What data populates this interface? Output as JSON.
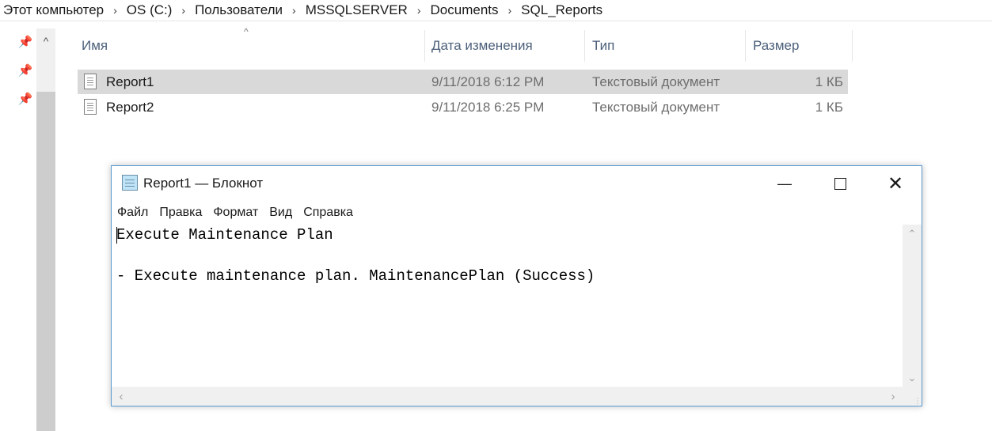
{
  "breadcrumb": {
    "items": [
      "Этот компьютер",
      "OS (C:)",
      "Пользователи",
      "MSSQLSERVER",
      "Documents",
      "SQL_Reports"
    ],
    "separator": "›"
  },
  "explorer": {
    "columns": {
      "name": "Имя",
      "date": "Дата изменения",
      "type": "Тип",
      "size": "Размер"
    },
    "sort_indicator": "^",
    "scroll_up": "^",
    "pin_icon": "📌",
    "files": [
      {
        "name": "Report1",
        "date": "9/11/2018 6:12 PM",
        "type": "Текстовый документ",
        "size": "1 КБ",
        "selected": true
      },
      {
        "name": "Report2",
        "date": "9/11/2018 6:25 PM",
        "type": "Текстовый документ",
        "size": "1 КБ",
        "selected": false
      }
    ]
  },
  "notepad": {
    "title": "Report1 — Блокнот",
    "buttons": {
      "minimize": "—",
      "close": "✕"
    },
    "menu": [
      "Файл",
      "Правка",
      "Формат",
      "Вид",
      "Справка"
    ],
    "content": "Execute Maintenance Plan\n\n- Execute maintenance plan. MaintenancePlan (Success)",
    "accent_color": "#5b9bd5"
  }
}
